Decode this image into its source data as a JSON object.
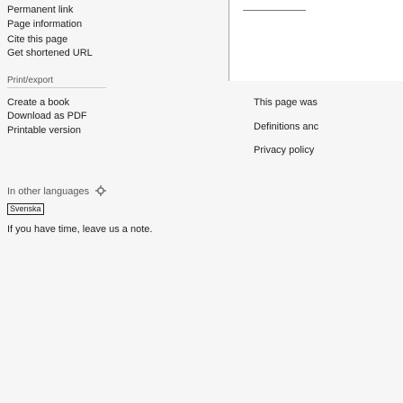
{
  "sidebar": {
    "tools_links": [
      {
        "label": "Permanent link"
      },
      {
        "label": "Page information"
      },
      {
        "label": "Cite this page"
      },
      {
        "label": "Get shortened URL"
      }
    ],
    "print_heading": "Print/export",
    "print_links": [
      {
        "label": "Create a book"
      },
      {
        "label": "Download as PDF"
      },
      {
        "label": "Printable version"
      }
    ],
    "languages": {
      "heading": "In other languages",
      "settings_icon": "gear-icon",
      "items": [
        {
          "label": "Svenska"
        }
      ]
    },
    "appeal": "If you have time, leave us a note."
  },
  "footer": {
    "last_edited": "This page was",
    "definitions": "Definitions anc",
    "privacy_policy": "Privacy policy"
  }
}
